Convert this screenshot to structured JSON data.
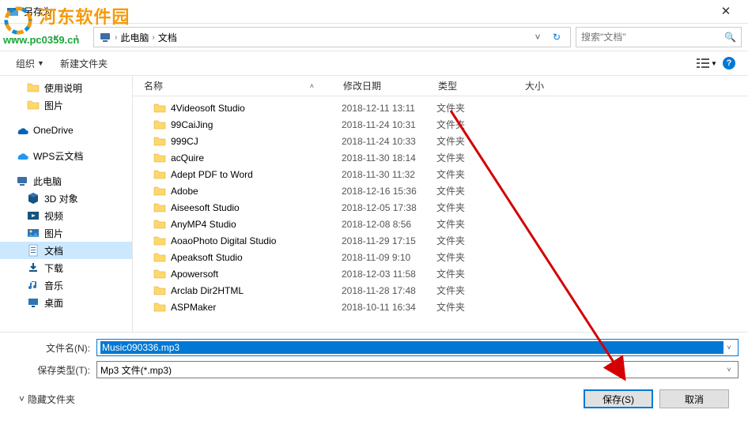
{
  "window": {
    "title": "另存为"
  },
  "watermark": {
    "line1": "河东软件园",
    "line2": "www.pc0359.cn"
  },
  "breadcrumb": {
    "seg1": "此电脑",
    "seg2": "文档"
  },
  "search": {
    "placeholder": "搜索\"文档\""
  },
  "toolbar": {
    "organize": "组织",
    "newfolder": "新建文件夹"
  },
  "columns": {
    "name": "名称",
    "date": "修改日期",
    "type": "类型",
    "size": "大小"
  },
  "sidebar": {
    "items": [
      {
        "label": "使用说明",
        "kind": "folder",
        "lvl": 2
      },
      {
        "label": "图片",
        "kind": "folder",
        "lvl": 2
      },
      {
        "gap": true
      },
      {
        "label": "OneDrive",
        "kind": "onedrive",
        "lvl": 1
      },
      {
        "gap": true
      },
      {
        "label": "WPS云文档",
        "kind": "wps",
        "lvl": 1
      },
      {
        "gap": true
      },
      {
        "label": "此电脑",
        "kind": "pc",
        "lvl": 1
      },
      {
        "label": "3D 对象",
        "kind": "3d",
        "lvl": 2
      },
      {
        "label": "视频",
        "kind": "video",
        "lvl": 2
      },
      {
        "label": "图片",
        "kind": "pics",
        "lvl": 2
      },
      {
        "label": "文档",
        "kind": "docs",
        "lvl": 2,
        "sel": true
      },
      {
        "label": "下载",
        "kind": "download",
        "lvl": 2
      },
      {
        "label": "音乐",
        "kind": "music",
        "lvl": 2
      },
      {
        "label": "桌面",
        "kind": "desktop",
        "lvl": 2
      }
    ]
  },
  "files": [
    {
      "name": "4Videosoft Studio",
      "date": "2018-12-11 13:11",
      "type": "文件夹"
    },
    {
      "name": "99CaiJing",
      "date": "2018-11-24 10:31",
      "type": "文件夹"
    },
    {
      "name": "999CJ",
      "date": "2018-11-24 10:33",
      "type": "文件夹"
    },
    {
      "name": "acQuire",
      "date": "2018-11-30 18:14",
      "type": "文件夹"
    },
    {
      "name": "Adept PDF to Word",
      "date": "2018-11-30 11:32",
      "type": "文件夹"
    },
    {
      "name": "Adobe",
      "date": "2018-12-16 15:36",
      "type": "文件夹"
    },
    {
      "name": "Aiseesoft Studio",
      "date": "2018-12-05 17:38",
      "type": "文件夹"
    },
    {
      "name": "AnyMP4 Studio",
      "date": "2018-12-08 8:56",
      "type": "文件夹"
    },
    {
      "name": "AoaoPhoto Digital Studio",
      "date": "2018-11-29 17:15",
      "type": "文件夹"
    },
    {
      "name": "Apeaksoft Studio",
      "date": "2018-11-09 9:10",
      "type": "文件夹"
    },
    {
      "name": "Apowersoft",
      "date": "2018-12-03 11:58",
      "type": "文件夹"
    },
    {
      "name": "Arclab Dir2HTML",
      "date": "2018-11-28 17:48",
      "type": "文件夹"
    },
    {
      "name": "ASPMaker",
      "date": "2018-10-11 16:34",
      "type": "文件夹"
    }
  ],
  "filename": {
    "label": "文件名(N):",
    "value": "Music090336.mp3"
  },
  "filetype": {
    "label": "保存类型(T):",
    "value": "Mp3 文件(*.mp3)"
  },
  "actions": {
    "hide": "隐藏文件夹",
    "save": "保存(S)",
    "cancel": "取消"
  }
}
